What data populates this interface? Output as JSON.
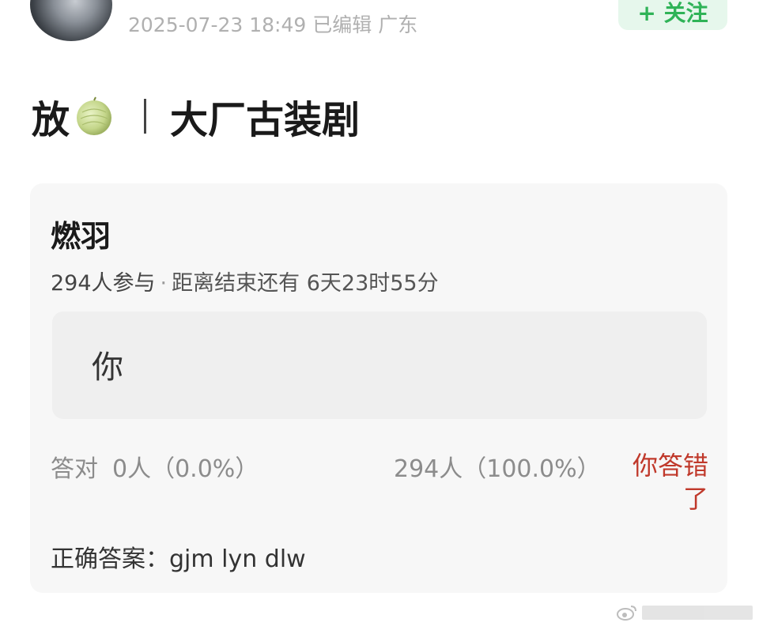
{
  "post": {
    "timestamp": "2025-07-23 18:49",
    "edited": "已编辑",
    "location": "广东",
    "follow_label": "+ 关注",
    "title_prefix": "放",
    "title_main": "大厂古装剧"
  },
  "quiz": {
    "name": "燃羽",
    "participants": "294人参与",
    "separator": "·",
    "remaining": "距离结束还有 6天23时55分",
    "option": "你",
    "correct_label": "答对",
    "correct_count": "0人（0.0%）",
    "wrong_count": "294人（100.0%）",
    "result": "你答错了",
    "answer": "正确答案：gjm lyn dlw"
  },
  "colors": {
    "accent_green": "#2fb357",
    "error_red": "#c0392b"
  },
  "icons": {
    "title_emoji": "melon-icon"
  }
}
